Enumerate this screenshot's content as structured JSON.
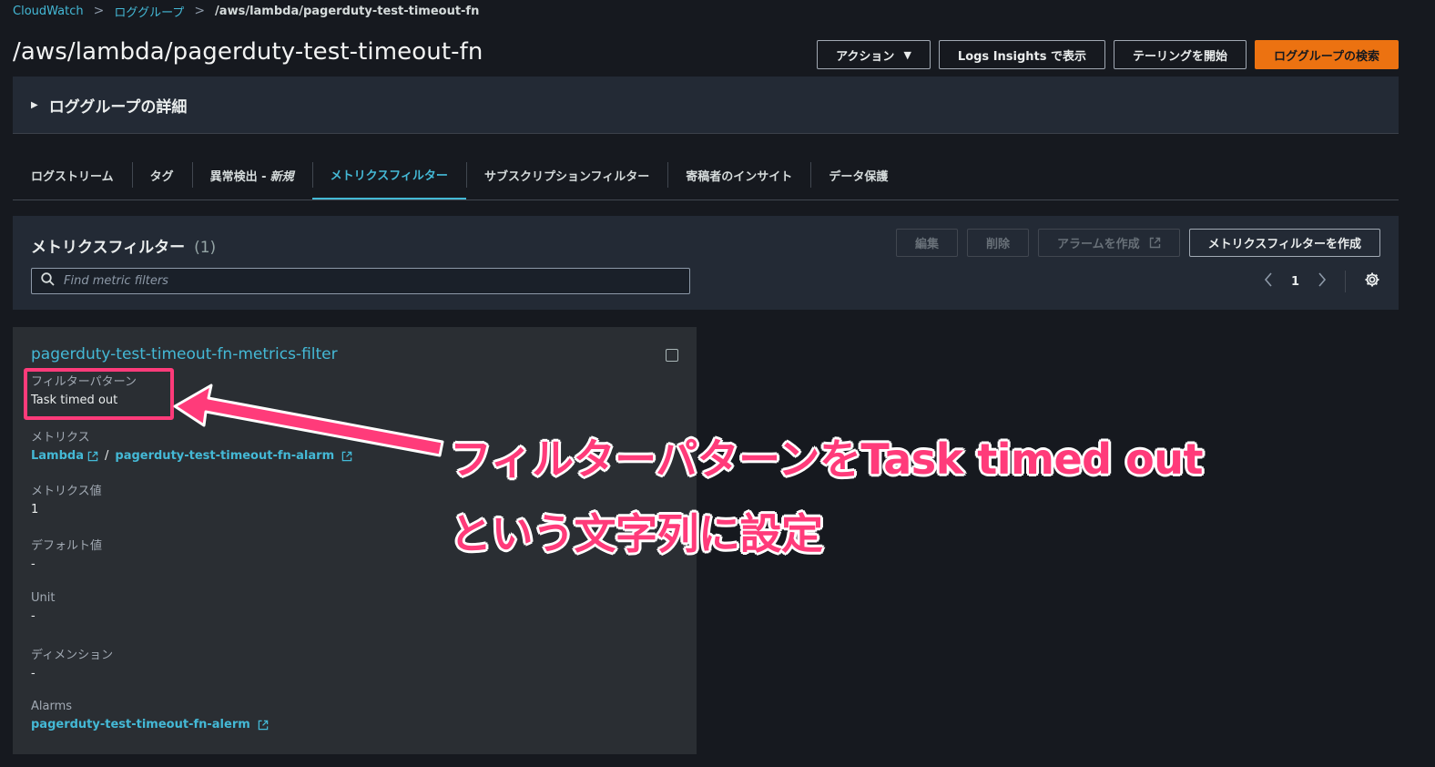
{
  "breadcrumb": {
    "items": [
      "CloudWatch",
      "ロググループ"
    ],
    "current": "/aws/lambda/pagerduty-test-timeout-fn"
  },
  "page_title": "/aws/lambda/pagerduty-test-timeout-fn",
  "header_buttons": {
    "actions": "アクション",
    "logs_insights": "Logs Insights で表示",
    "tailing": "テーリングを開始",
    "search_log_group": "ロググループの検索"
  },
  "details": {
    "label": "ロググループの詳細"
  },
  "tabs": [
    {
      "label": "ログストリーム"
    },
    {
      "label": "タグ"
    },
    {
      "label": "異常検出 -",
      "emphasis": "新規"
    },
    {
      "label": "メトリクスフィルター"
    },
    {
      "label": "サブスクリプションフィルター"
    },
    {
      "label": "寄稿者のインサイト"
    },
    {
      "label": "データ保護"
    }
  ],
  "panel": {
    "title": "メトリクスフィルター",
    "count": "(1)",
    "buttons": {
      "edit": "編集",
      "delete": "削除",
      "create_alarm": "アラームを作成",
      "create_filter": "メトリクスフィルターを作成"
    },
    "search_placeholder": "Find metric filters",
    "page": "1"
  },
  "card": {
    "title": "pagerduty-test-timeout-fn-metrics-filter",
    "filter_pattern": {
      "label": "フィルターパターン",
      "value": "Task timed out"
    },
    "metrics": {
      "label": "メトリクス",
      "namespace": "Lambda",
      "sep": "/",
      "metric": "pagerduty-test-timeout-fn-alarm"
    },
    "metric_value": {
      "label": "メトリクス値",
      "value": "1"
    },
    "default_value": {
      "label": "デフォルト値",
      "value": "-"
    },
    "unit": {
      "label": "Unit",
      "value": "-"
    },
    "dimensions": {
      "label": "ディメンション",
      "value": "-"
    },
    "alarms": {
      "label": "Alarms",
      "value": "pagerduty-test-timeout-fn-alerm"
    }
  },
  "annotation": {
    "line1": "フィルターパターンをTask timed out",
    "line2": "という文字列に設定"
  },
  "colors": {
    "accent": "#44b9d6",
    "primary_button": "#ec7211",
    "annotation": "#ff3b7a"
  }
}
